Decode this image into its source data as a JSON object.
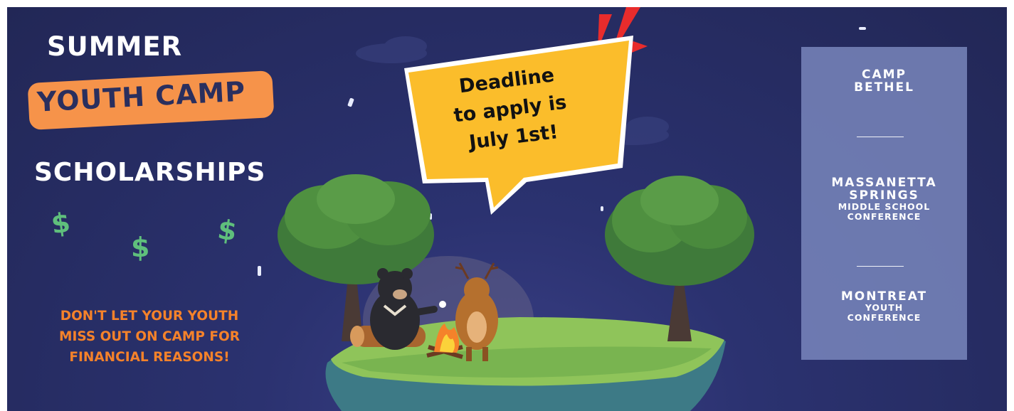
{
  "banner": {
    "title_line1": "SUMMER",
    "title_line2": "YOUTH CAMP",
    "title_line3": "SCHOLARSHIPS",
    "dollar_symbol": "$",
    "tagline_lines": [
      "DON'T LET YOUR YOUTH",
      "MISS OUT ON CAMP FOR",
      "FINANCIAL REASONS!"
    ]
  },
  "speech_bubble": {
    "lines": [
      "Deadline",
      "to apply is",
      "July 1st!"
    ]
  },
  "camps_panel": {
    "camp1": {
      "lines": [
        "CAMP",
        "BETHEL"
      ]
    },
    "camp2": {
      "big_lines": [
        "MASSANETTA",
        "SPRINGS"
      ],
      "small_lines": [
        "MIDDLE SCHOOL",
        "CONFERENCE"
      ]
    },
    "camp3": {
      "big_lines": [
        "MONTREAT"
      ],
      "small_lines": [
        "YOUTH",
        "CONFERENCE"
      ]
    }
  },
  "colors": {
    "background": "#262c62",
    "accent_orange": "#f6934a",
    "tagline_orange": "#f5822a",
    "bubble_yellow": "#fbbd2b",
    "dollar_green": "#5fbf7c",
    "panel": "#808ec4"
  },
  "illustration": {
    "icons": [
      "bear-icon",
      "deer-icon",
      "campfire-icon",
      "tree-icon",
      "log-icon",
      "island-icon",
      "cloud-icon"
    ]
  }
}
